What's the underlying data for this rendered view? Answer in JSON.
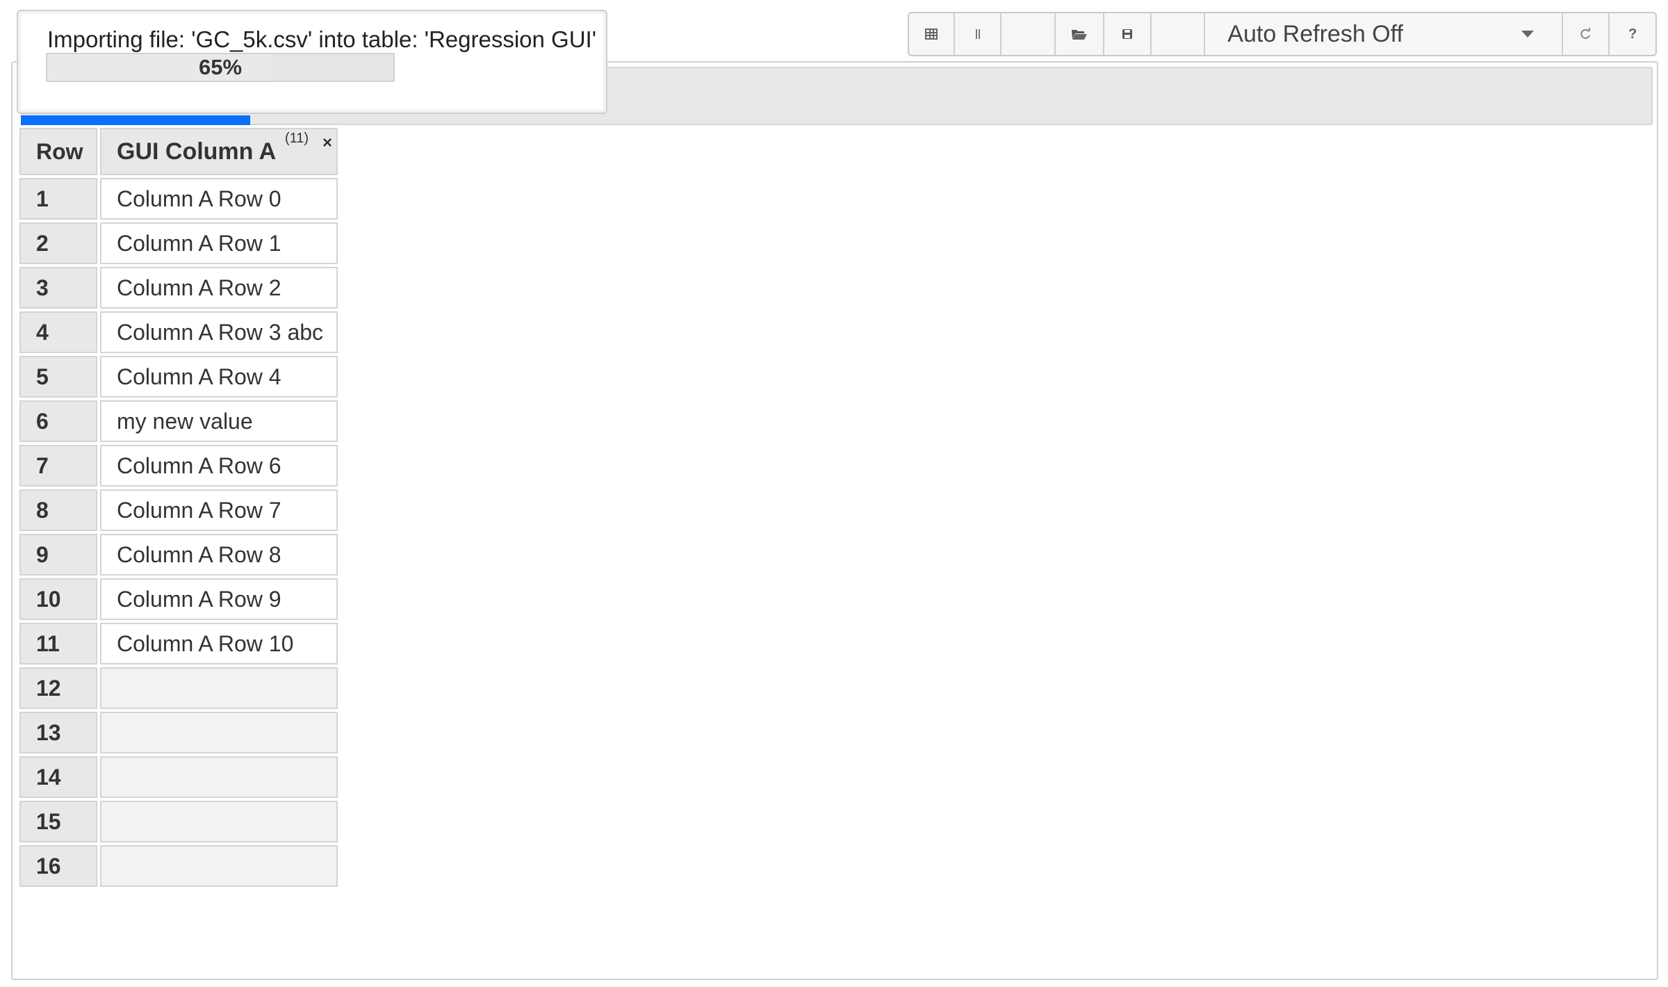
{
  "toolbar": {
    "buttons": [
      {
        "name": "table-icon"
      },
      {
        "name": "columns-icon"
      },
      {
        "name": "blank"
      },
      {
        "name": "folder-open-icon"
      },
      {
        "name": "save-icon"
      },
      {
        "name": "blank"
      }
    ],
    "refresh_select": {
      "value": "Auto Refresh Off"
    },
    "refresh_icon": "refresh-icon",
    "help_label": "?"
  },
  "import_dialog": {
    "title": "Importing file: 'GC_5k.csv' into table: 'Regression GUI'",
    "progress": 0.65,
    "progress_label": "65%"
  },
  "table": {
    "row_header": "Row",
    "column": {
      "label": "GUI Column A",
      "count_badge": "(11)",
      "close_label": "×"
    },
    "rows": [
      {
        "num": "1",
        "value": "Column A Row 0"
      },
      {
        "num": "2",
        "value": "Column A Row 1"
      },
      {
        "num": "3",
        "value": "Column A Row 2"
      },
      {
        "num": "4",
        "value": "Column A Row 3 abc"
      },
      {
        "num": "5",
        "value": "Column A Row 4"
      },
      {
        "num": "6",
        "value": "my new value"
      },
      {
        "num": "7",
        "value": "Column A Row 6"
      },
      {
        "num": "8",
        "value": "Column A Row 7"
      },
      {
        "num": "9",
        "value": "Column A Row 8"
      },
      {
        "num": "10",
        "value": "Column A Row 9"
      },
      {
        "num": "11",
        "value": "Column A Row 10"
      },
      {
        "num": "12",
        "value": ""
      },
      {
        "num": "13",
        "value": ""
      },
      {
        "num": "14",
        "value": ""
      },
      {
        "num": "15",
        "value": ""
      },
      {
        "num": "16",
        "value": ""
      }
    ]
  },
  "colors": {
    "active_tab": "#0b6efd",
    "header_bg": "#e8e8e8"
  }
}
